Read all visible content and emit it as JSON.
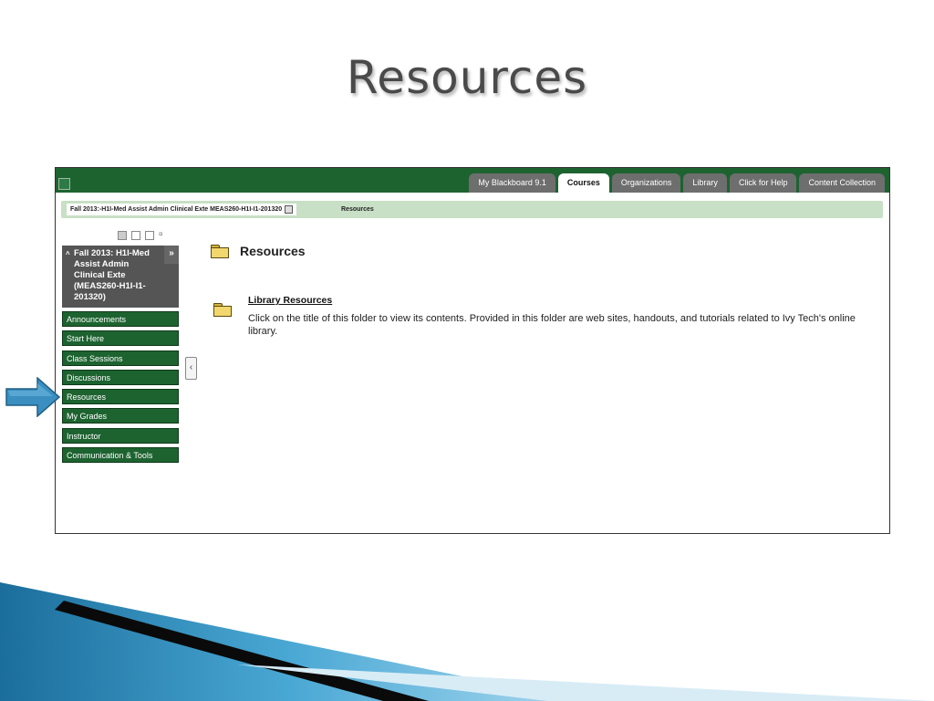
{
  "slide": {
    "title": "Resources"
  },
  "topbar": {
    "tabs": [
      {
        "label": "My Blackboard 9.1",
        "active": false
      },
      {
        "label": "Courses",
        "active": true
      },
      {
        "label": "Organizations",
        "active": false
      },
      {
        "label": "Library",
        "active": false
      },
      {
        "label": "Click for Help",
        "active": false
      },
      {
        "label": "Content Collection",
        "active": false
      }
    ]
  },
  "breadcrumb": {
    "course": "Fall 2013:-H1I-Med Assist Admin Clinical Exte MEAS260-H1I-I1-201320",
    "current": "Resources"
  },
  "sidebar": {
    "course_title": "Fall 2013: H1I-Med Assist Admin Clinical Exte (MEAS260-H1I-I1-201320)",
    "items": [
      {
        "label": "Announcements"
      },
      {
        "label": "Start Here"
      },
      {
        "label": "Class Sessions"
      },
      {
        "label": "Discussions"
      },
      {
        "label": "Resources"
      },
      {
        "label": "My Grades"
      },
      {
        "label": "Instructor"
      },
      {
        "label": "Communication & Tools"
      }
    ]
  },
  "content": {
    "heading": "Resources",
    "items": [
      {
        "title": "Library Resources",
        "description": "Click on the title of this folder to view its contents. Provided in this folder are web sites, handouts, and tutorials related to Ivy Tech's online library."
      }
    ]
  },
  "colors": {
    "bb_green": "#1d6330",
    "breadcrumb_bg": "#c8e0c5",
    "arrow_blue": "#3a8fc0"
  }
}
